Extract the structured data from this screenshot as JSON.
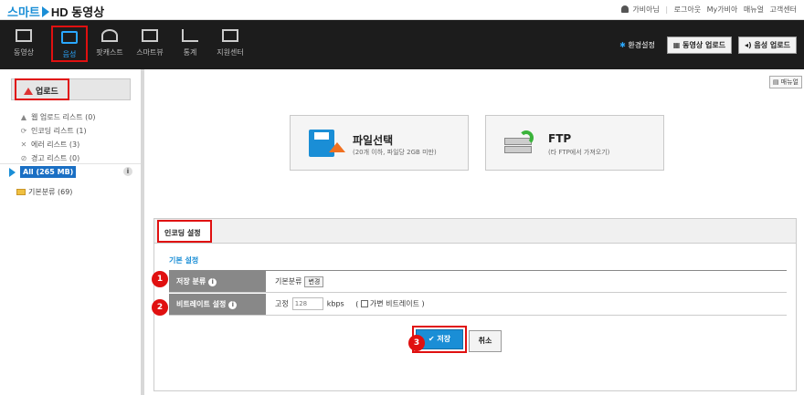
{
  "brand": {
    "smart": "스마트",
    "rest": "HD 동영상"
  },
  "top_links": {
    "user": "가비아님",
    "logout": "로그아웃",
    "my": "My가비아",
    "manual": "매뉴얼",
    "support": "고객센터"
  },
  "nav": [
    {
      "label": "동영상",
      "icon": "film-icon"
    },
    {
      "label": "음성",
      "icon": "speaker-icon",
      "active": true
    },
    {
      "label": "팟캐스트",
      "icon": "wifi-icon"
    },
    {
      "label": "스마트뷰",
      "icon": "monitor-icon"
    },
    {
      "label": "통계",
      "icon": "chart-icon"
    },
    {
      "label": "지원센터",
      "icon": "support-icon"
    }
  ],
  "toolbar": {
    "env": "환경설정",
    "video_upload": "동영상 업로드",
    "audio_upload": "음성 업로드"
  },
  "sidebar": {
    "upload": "업로드",
    "items": [
      "웹 업로드 리스트 (0)",
      "인코딩 리스트 (1)",
      "에러 리스트 (3)",
      "경고 리스트 (0)"
    ],
    "all": "All (265 MB)",
    "folder": "기본분류 (69)"
  },
  "main": {
    "manual": "매뉴얼",
    "file_title": "파일선택",
    "file_sub": "(20개 이하, 파일당 2GB 미만)",
    "ftp_title": "FTP",
    "ftp_sub": "(타 FTP에서 가져오기)",
    "tab": "인코딩 설정",
    "section": "기본 설정",
    "row1_label": "저장 분류",
    "row1_value": "기본분류",
    "row1_btn": "변경",
    "row2_label": "비트레이트 설정",
    "row2_fixed": "고정",
    "row2_placeholder": "128",
    "row2_unit": "kbps",
    "row2_open": "(",
    "row2_var": "가변 비트레이트",
    "row2_close": ")",
    "save": "저장",
    "cancel": "취소"
  },
  "badges": [
    "1",
    "2",
    "3"
  ],
  "colors": {
    "accent": "#1a8ed6",
    "highlight": "#e01010"
  }
}
